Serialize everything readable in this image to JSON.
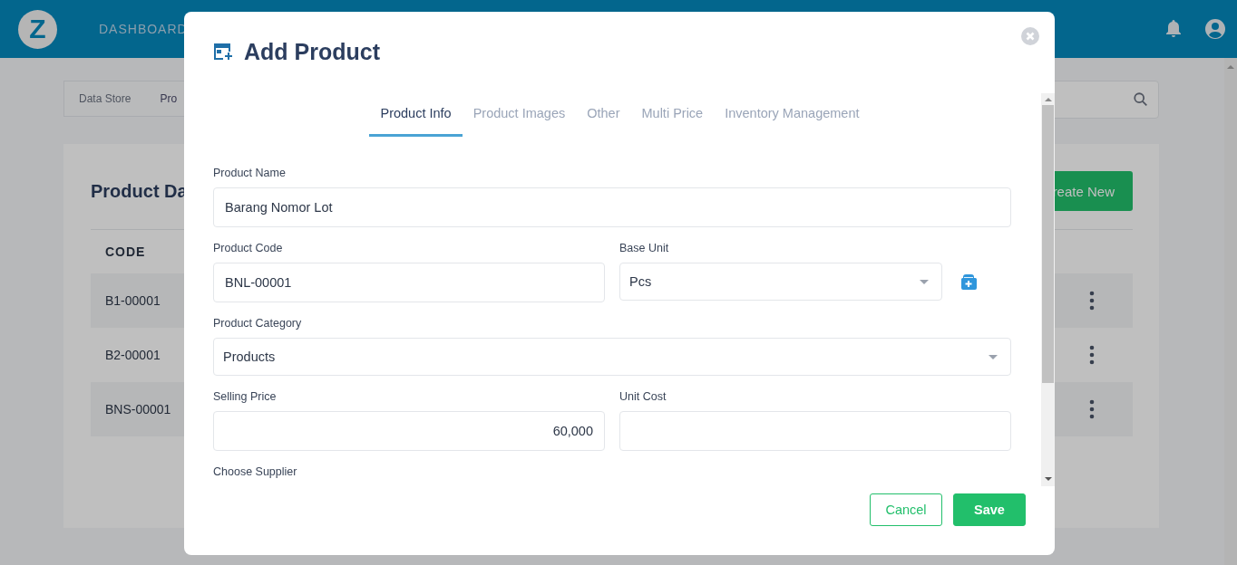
{
  "header": {
    "logo": "Z",
    "nav": [
      "DASHBOARD"
    ]
  },
  "breadcrumb": [
    "Data Store",
    "Pro"
  ],
  "card": {
    "title": "Product Da",
    "create_button": "reate New",
    "table": {
      "columns": [
        "CODE"
      ],
      "rows": [
        {
          "code": "B1-00001"
        },
        {
          "code": "B2-00001"
        },
        {
          "code": "BNS-00001"
        }
      ]
    }
  },
  "modal": {
    "title": "Add Product",
    "tabs": [
      {
        "label": "Product Info",
        "selected": true
      },
      {
        "label": "Product Images",
        "selected": false
      },
      {
        "label": "Other",
        "selected": false
      },
      {
        "label": "Multi Price",
        "selected": false
      },
      {
        "label": "Inventory Management",
        "selected": false
      }
    ],
    "rows": [
      [
        {
          "label": "Product Name",
          "kind": "text",
          "value": "Barang Nomor Lot"
        }
      ],
      [
        {
          "label": "Product Code",
          "kind": "text",
          "value": "BNL-00001"
        },
        {
          "label": "Base Unit",
          "kind": "select-add",
          "value": "Pcs"
        }
      ],
      [
        {
          "label": "Product Category",
          "kind": "select",
          "value": "Products"
        }
      ],
      [
        {
          "label": "Selling Price",
          "kind": "number",
          "value": "60,000"
        },
        {
          "label": "Unit Cost",
          "kind": "number"
        }
      ],
      [
        {
          "label": "Choose Supplier",
          "kind": "label"
        }
      ]
    ],
    "buttons": [
      {
        "label": "Cancel",
        "kind": "secondary"
      },
      {
        "label": "Save",
        "kind": "primary"
      }
    ]
  }
}
